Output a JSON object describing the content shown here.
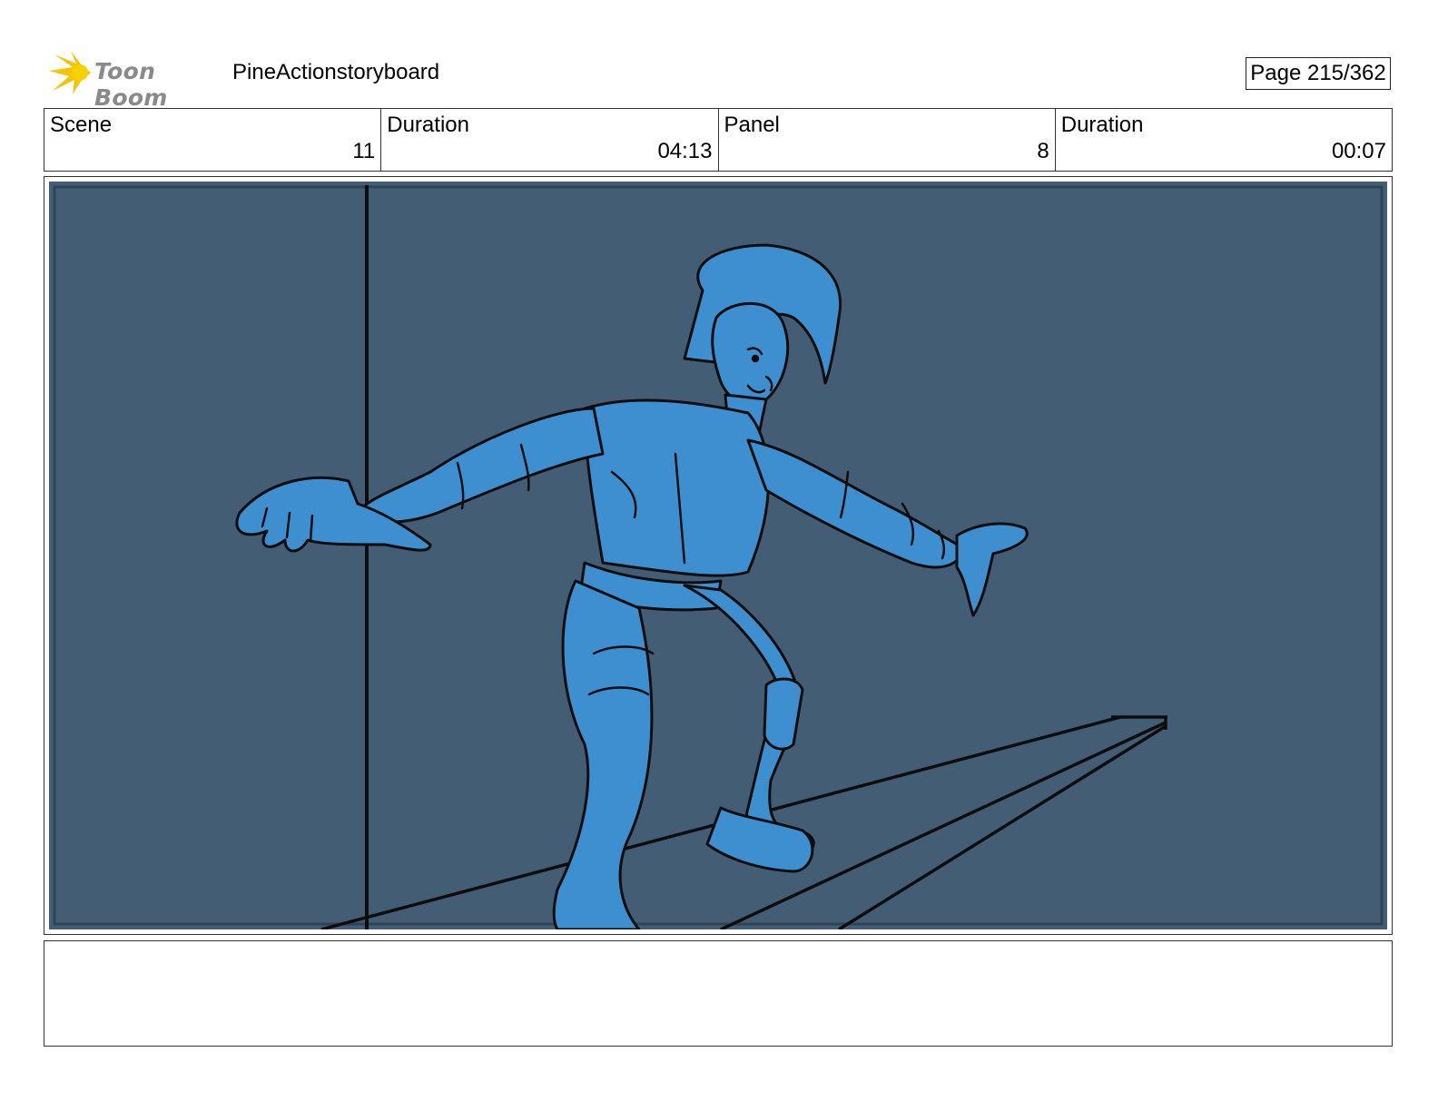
{
  "header": {
    "logo_text": "Toon Boom",
    "document_title": "PineActionstoryboard",
    "page_label": "Page 215/362"
  },
  "info": {
    "scene_label": "Scene",
    "scene_value": "11",
    "scene_duration_label": "Duration",
    "scene_duration_value": "04:13",
    "panel_label": "Panel",
    "panel_value": "8",
    "panel_duration_label": "Duration",
    "panel_duration_value": "00:07"
  },
  "notes": {
    "text": ""
  },
  "colors": {
    "background_fill": "#435d74",
    "character_fill": "#3e8fd0",
    "ink": "#0d0d0d",
    "logo_yellow": "#f5c400"
  },
  "icons": {
    "logo": "toon-boom-star-icon"
  }
}
